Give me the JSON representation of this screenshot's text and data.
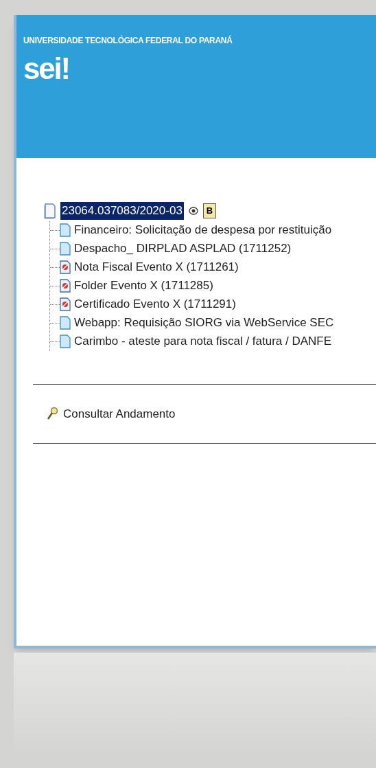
{
  "header": {
    "institution": "UNIVERSIDADE TECNOLÓGICA FEDERAL DO PARANÁ",
    "logo": "sei!"
  },
  "tree": {
    "label": "23064.037083/2020-03",
    "selected": true,
    "badge": "B",
    "children": [
      {
        "label": "Financeiro: Solicitação de despesa por restituição",
        "kind": "document"
      },
      {
        "label": "Despacho_ DIRPLAD ASPLAD (1711252)",
        "kind": "document"
      },
      {
        "label": "Nota Fiscal Evento X (1711261)",
        "kind": "pdf"
      },
      {
        "label": "Folder Evento X (1711285)",
        "kind": "pdf"
      },
      {
        "label": "Certificado Evento X (1711291)",
        "kind": "pdf"
      },
      {
        "label": "Webapp: Requisição SIORG via WebService SEC",
        "kind": "document"
      },
      {
        "label": "Carimbo - ateste para nota fiscal / fatura / DANFE",
        "kind": "document"
      }
    ]
  },
  "actions": [
    {
      "label": "Consultar Andamento"
    }
  ]
}
